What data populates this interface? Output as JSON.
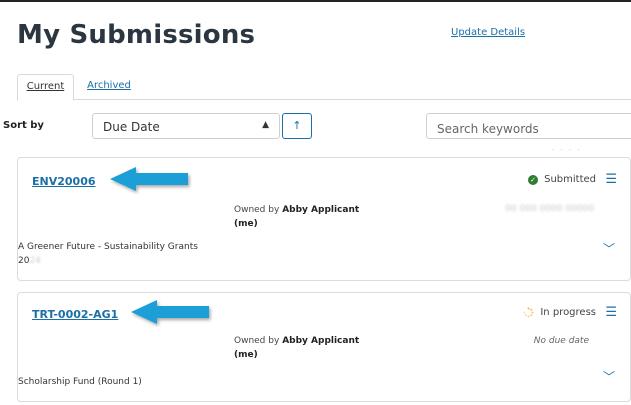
{
  "header": {
    "title": "My Submissions",
    "update_link": "Update Details"
  },
  "tabs": [
    {
      "label": "Current",
      "active": true
    },
    {
      "label": "Archived",
      "active": false
    }
  ],
  "sort": {
    "label": "Sort by",
    "selected": "Due Date",
    "direction_icon": "↑"
  },
  "search": {
    "placeholder": "Search keywords"
  },
  "submissions": [
    {
      "id": "ENV20006",
      "owner_prefix": "Owned by",
      "owner_name": "Abby Applicant",
      "owner_suffix": "(me)",
      "status": "Submitted",
      "status_icon": "check-circle-icon",
      "due": "",
      "title": "A Greener Future - Sustainability Grants 20",
      "title_hidden": "24"
    },
    {
      "id": "TRT-0002-AG1",
      "owner_prefix": "Owned by",
      "owner_name": "Abby Applicant",
      "owner_suffix": "(me)",
      "status": "In progress",
      "status_icon": "spinner-icon",
      "due": "No due date",
      "title": "Scholarship Fund (Round 1)"
    }
  ],
  "colors": {
    "link": "#1a6fa8",
    "arrow": "#1a9ed6",
    "submitted": "#2e7d32",
    "in_progress": "#f2b233"
  }
}
